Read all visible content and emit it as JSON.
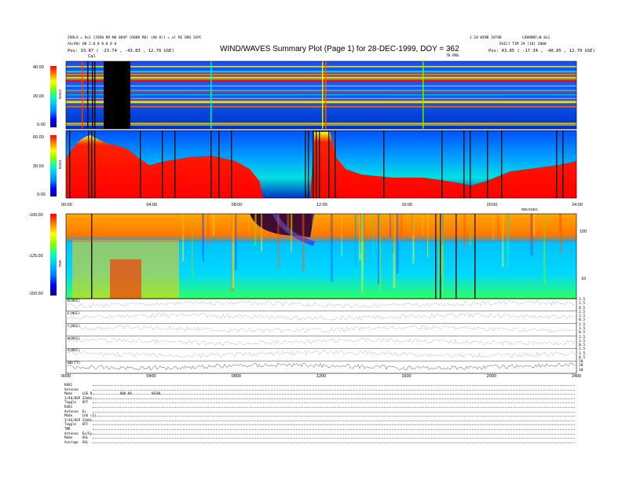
{
  "header": {
    "left_line1": "ZOOLO = 8x1 [ZOO0 NP-N0 00SP (R000 R0) (00 0)] = ul RE ORQ 3SPC",
    "left_line2": "AS(R0) 00 2.0 0 0.0 0 0",
    "left_pos": "Pos:    33.87 ( -23.74 , -43.83 , 12.79 GSE)",
    "title": "WIND/WAVES Summary Plot (Page 1) for 28-DEC-1999, DOY = 362",
    "subtitle": "TB RMS",
    "right_line1": "1.10 WIND 2UT00",
    "right_line2": "DAILY  TIM 29 [10] 2000",
    "right_station": "LD80NOF=N 8x1",
    "right_pos": "Pos:    43.85 ( -17.34 , -40.85 , 12.79 GSE)"
  },
  "colors": {
    "background": "#ffffff",
    "spectrum": [
      "#000080",
      "#0000ff",
      "#0080ff",
      "#00c0ff",
      "#00ffc0",
      "#80ff00",
      "#ffff00",
      "#ff8000",
      "#ff0000"
    ]
  },
  "panels": {
    "rad2": {
      "label": "RAD2",
      "ticks": [
        "40.00",
        "20.00",
        "0.00"
      ]
    },
    "rad1": {
      "label": "RAD1",
      "ticks": [
        "60.00",
        "30.00",
        "0.00"
      ]
    },
    "tnr": {
      "label": "TNR",
      "ticks": [
        "-100.00",
        "-125.00",
        "-150.00"
      ],
      "right_ticks": [
        "100",
        "10"
      ]
    },
    "time_axis_mid": [
      "00:00",
      "04:00",
      "08:00",
      "12:00",
      "16:00",
      "20:00",
      "24:00"
    ],
    "time_axis_mid_tag": "RBV2SEC",
    "cal_marker": "Cal",
    "line_panels": [
      {
        "label": "B(NSC)",
        "right_ticks": [
          "2.5",
          "1.5",
          "0.5"
        ]
      },
      {
        "label": "E(NSC)",
        "right_ticks": [
          "2.5",
          "1.5",
          "0.5"
        ]
      },
      {
        "label": "C(NSC)",
        "right_ticks": [
          "2.5",
          "1.5",
          "0.5"
        ]
      },
      {
        "label": "W(NSC)",
        "right_ticks": [
          "2.5",
          "1.5",
          "0.5"
        ]
      },
      {
        "label": "A(NSC)",
        "right_ticks": [
          "2.5",
          "1.5",
          "0.5"
        ]
      },
      {
        "label": "BB(TT)",
        "right_ticks": [
          "50",
          "20",
          "10"
        ]
      }
    ],
    "time_axis_bottom": [
      "0000",
      "0400",
      "0800",
      "1200",
      "1600",
      "2000",
      "2400"
    ]
  },
  "footer": [
    "RAD2",
    "Antenna",
    "Mode     LOG 0              000 K0          HIGHL",
    "3/46/8SP 32kHz",
    "Toggle   OFF",
    "RAD1",
    "Antenna  Ex",
    "Mode     LOG (3)",
    "3/46/8SP 32kHz",
    "Toggle   OFF",
    "TNR",
    "Antenna  Ex/Ey",
    "Mode     AGL",
    "Average  AGL"
  ],
  "chart_data": {
    "type": "heatmap",
    "title": "WIND/WAVES Summary Plot (Page 1) for 28-DEC-1999, DOY = 362",
    "xlabel": "",
    "x_range": [
      "00:00",
      "24:00"
    ],
    "panels": [
      {
        "name": "RAD2",
        "ylim": [
          0,
          40
        ]
      },
      {
        "name": "RAD1",
        "ylim": [
          0,
          60
        ]
      },
      {
        "name": "TNR",
        "ylim": [
          -150,
          -100
        ]
      }
    ]
  }
}
